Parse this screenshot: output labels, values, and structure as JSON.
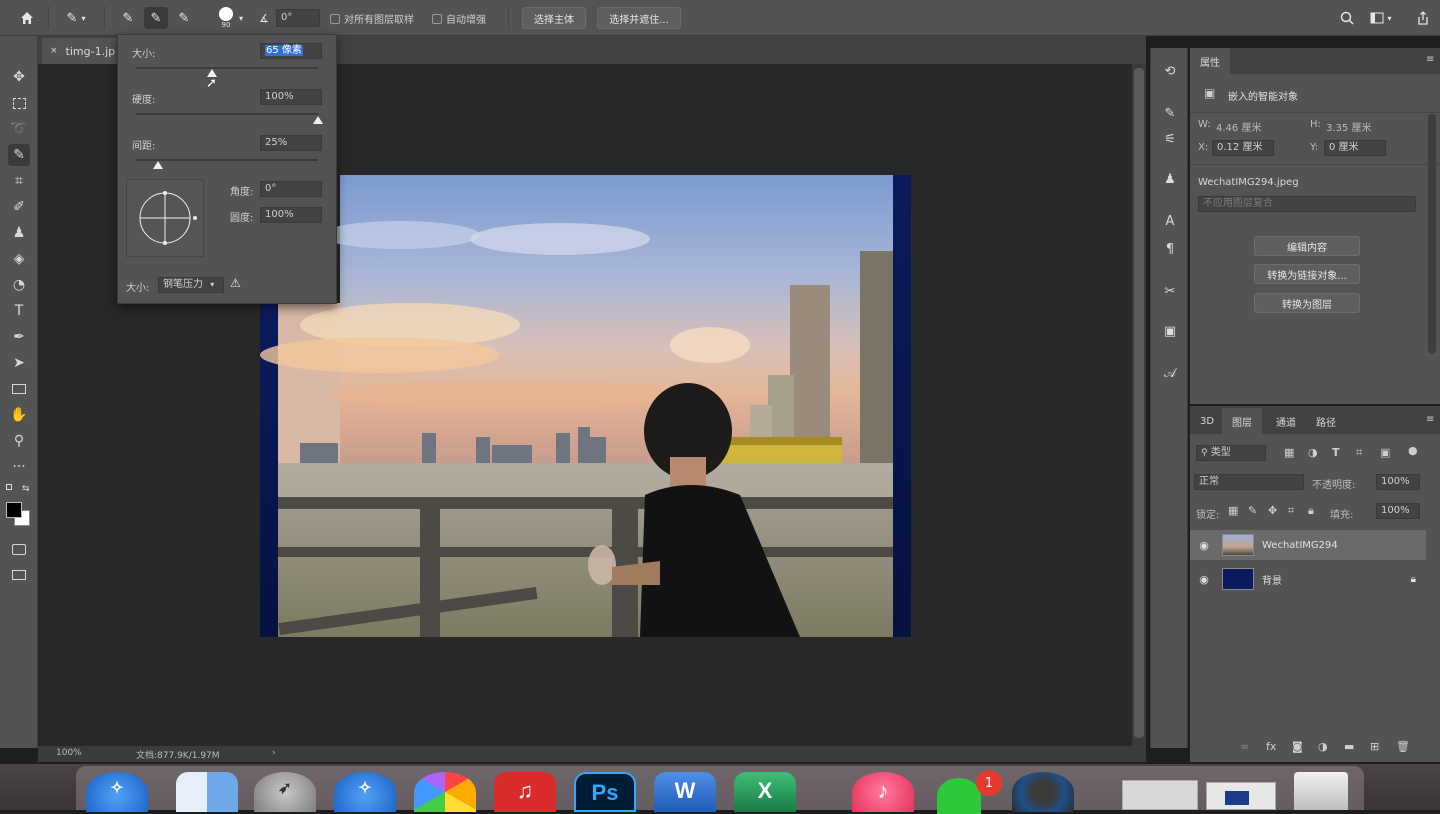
{
  "options_bar": {
    "brush_size_value": "90",
    "angle_value": "0°",
    "sample_all_layers": "对所有图层取样",
    "auto_enhance": "自动增强",
    "select_subject": "选择主体",
    "select_and_mask": "选择并遮住..."
  },
  "document": {
    "tab_title": "timg-1.jp",
    "zoom": "100%",
    "doc_size": "文档:877.9K/1.97M"
  },
  "brush_popup": {
    "size_label": "大小:",
    "size_value": "65 像素",
    "size_fraction": 0.42,
    "hardness_label": "硬度:",
    "hardness_value": "100%",
    "hardness_fraction": 1.0,
    "spacing_label": "间距:",
    "spacing_value": "25%",
    "spacing_fraction": 0.12,
    "angle_label": "角度:",
    "angle_value": "0°",
    "roundness_label": "圆度:",
    "roundness_value": "100%",
    "pressure_label": "大小:",
    "pressure_value": "钢笔压力"
  },
  "properties": {
    "tab_title": "属性",
    "object_type": "嵌入的智能对象",
    "w_label": "W:",
    "w_value": "4.46 厘米",
    "h_label": "H:",
    "h_value": "3.35 厘米",
    "x_label": "X:",
    "x_value": "0.12 厘米",
    "y_label": "Y:",
    "y_value": "0 厘米",
    "filename": "WechatIMG294.jpeg",
    "comp_placeholder": "不应用图层复合",
    "edit_contents": "编辑内容",
    "convert_linked": "转换为链接对象...",
    "convert_layers": "转换为图层"
  },
  "layers_panel": {
    "tabs": [
      "3D",
      "图层",
      "通道",
      "路径"
    ],
    "filter_kind": "类型",
    "blend_mode": "正常",
    "opacity_label": "不透明度:",
    "opacity_value": "100%",
    "lock_label": "锁定:",
    "fill_label": "填充:",
    "fill_value": "100%",
    "layers": [
      {
        "name": "WechatIMG294"
      },
      {
        "name": "背景"
      }
    ]
  },
  "dock": {
    "wechat_badge": "1",
    "apps": [
      "safari",
      "finder",
      "launchpad",
      "safari",
      "photos",
      "netease-music",
      "Ps",
      "W",
      "X",
      "music",
      "wechat",
      "quicktime"
    ]
  },
  "colors": {
    "panel": "#535353",
    "canvas": "#282828",
    "accent": "#2f6fd6"
  }
}
